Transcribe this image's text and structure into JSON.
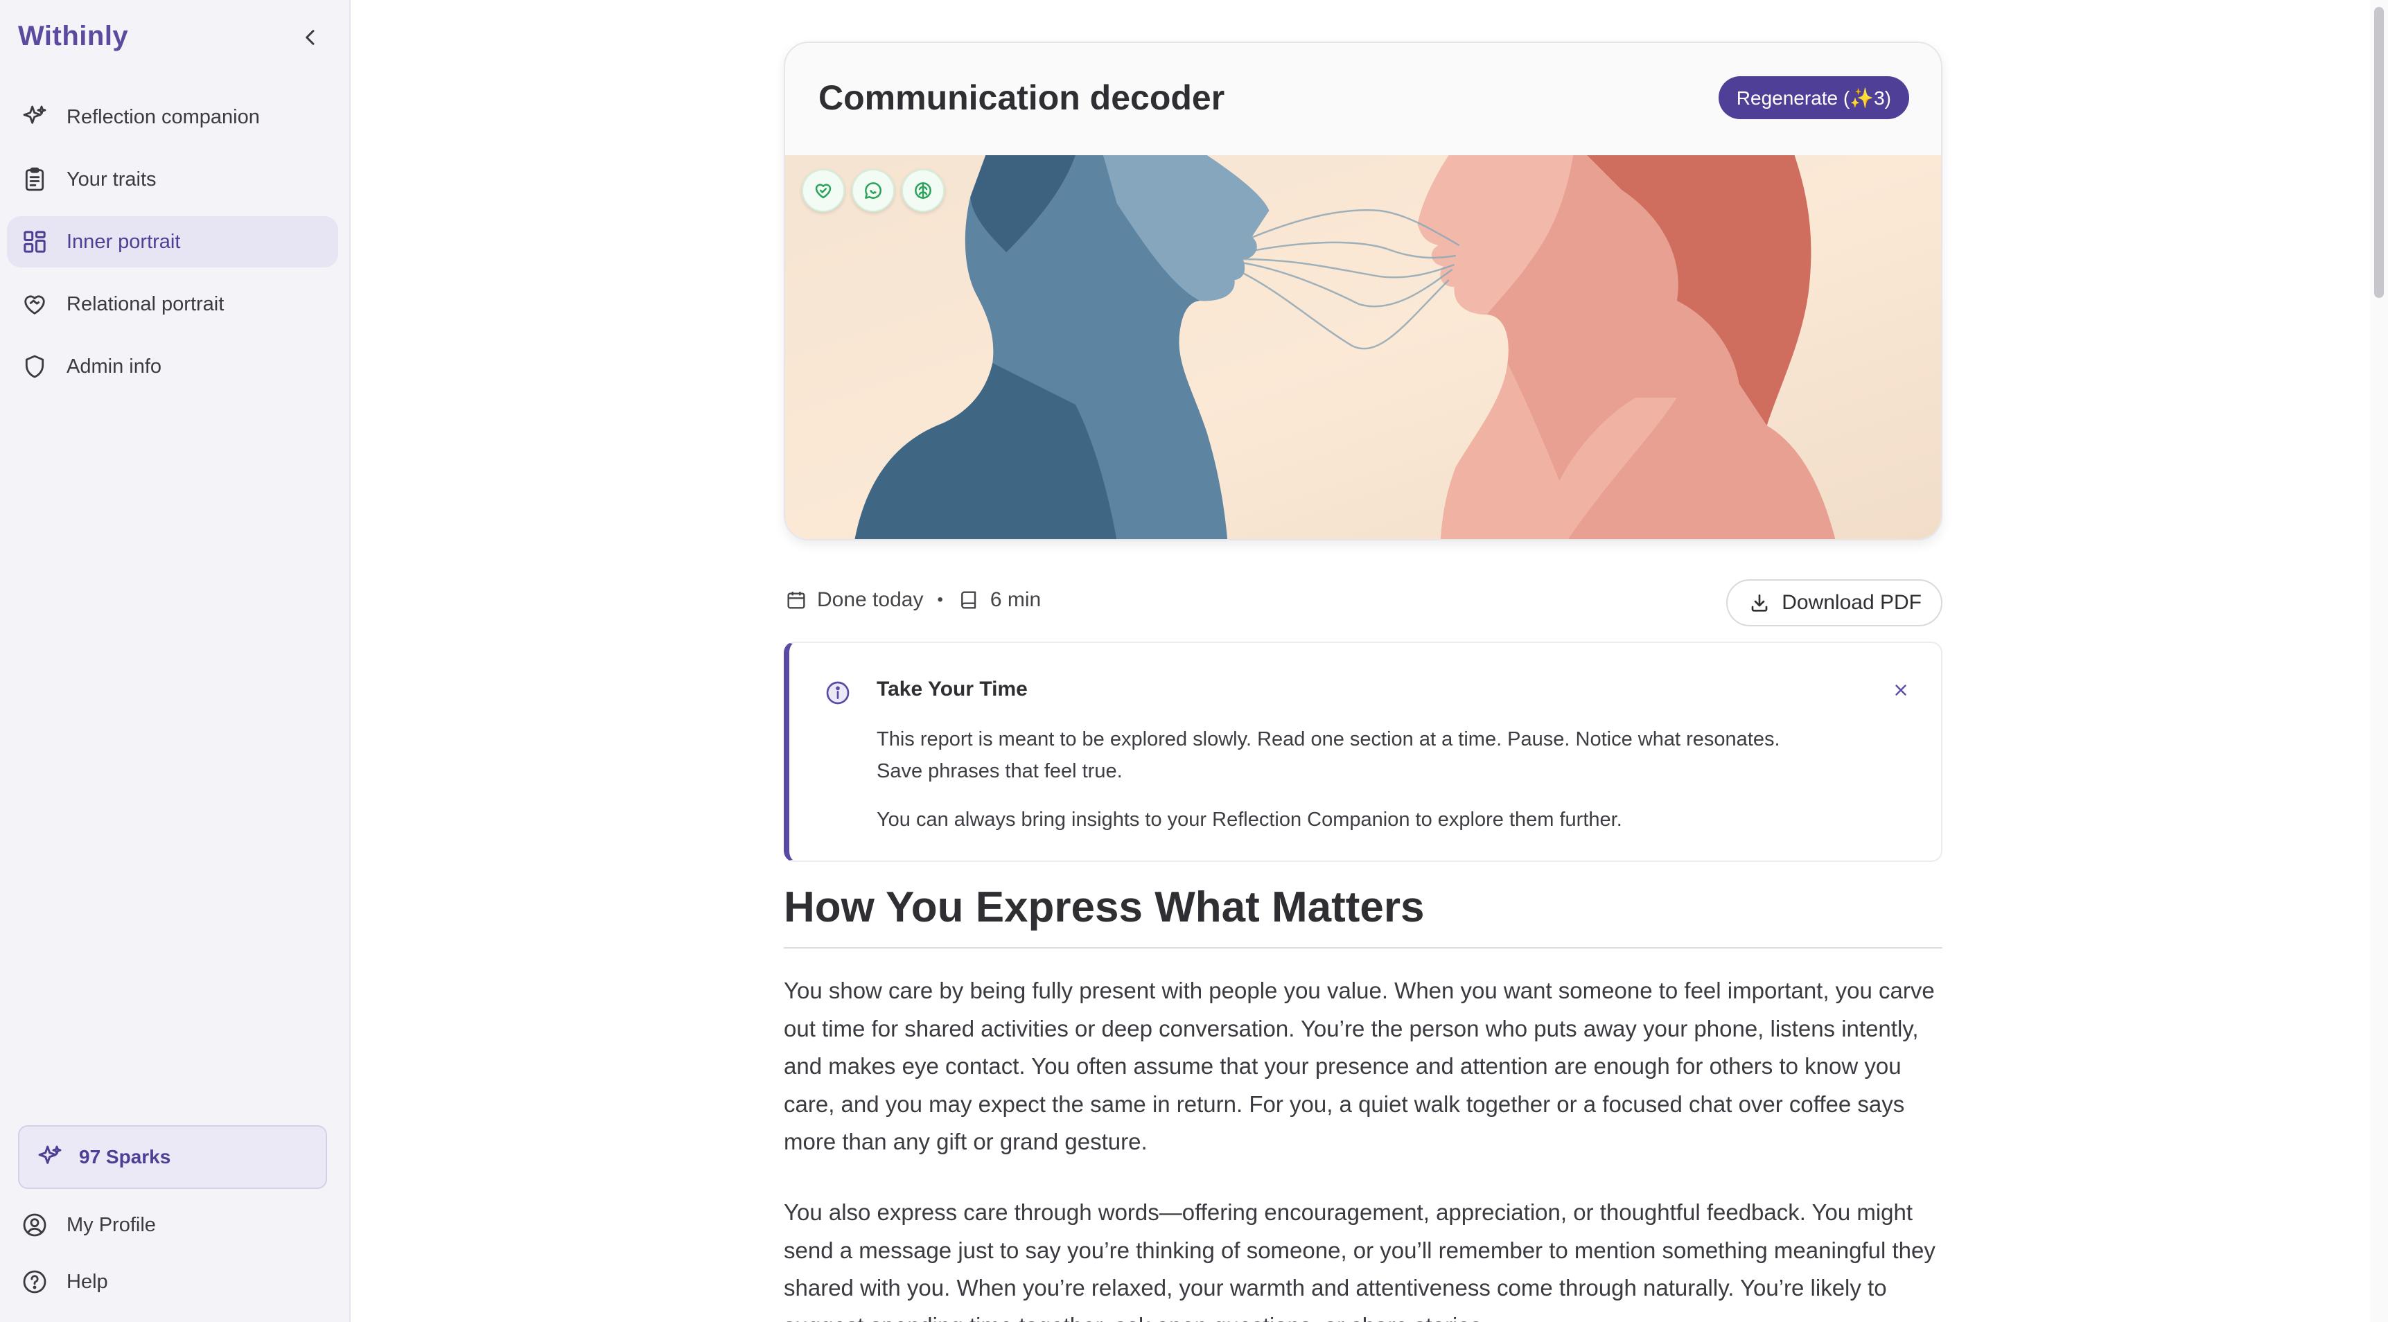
{
  "app": {
    "brand": "Withinly"
  },
  "sidebar": {
    "items": [
      {
        "label": "Reflection companion",
        "icon": "sparkles-icon"
      },
      {
        "label": "Your traits",
        "icon": "clipboard-icon"
      },
      {
        "label": "Inner portrait",
        "icon": "grid-icon",
        "active": true
      },
      {
        "label": "Relational portrait",
        "icon": "heart-handshake-icon"
      },
      {
        "label": "Admin info",
        "icon": "shield-icon"
      }
    ],
    "sparks_label": "97 Sparks",
    "profile_label": "My Profile",
    "help_label": "Help"
  },
  "card": {
    "title": "Communication decoder",
    "regenerate_label": "Regenerate (✨3)",
    "chips": [
      "heart-check-icon",
      "chat-bubble-icon",
      "brain-icon"
    ]
  },
  "meta": {
    "date": "Done today",
    "separator": "•",
    "duration": "6 min",
    "download_label": "Download PDF"
  },
  "notice": {
    "title": "Take Your Time",
    "line1": "This report is meant to be explored slowly. Read one section at a time. Pause. Notice what resonates.",
    "line2": "Save phrases that feel true.",
    "line3": "You can always bring insights to your Reflection Companion to explore them further."
  },
  "section": {
    "title": "How You Express What Matters",
    "para1": "You show care by being fully present with people you value. When you want someone to feel important, you carve out time for shared activities or deep conversation. You’re the person who puts away your phone, listens intently, and makes eye contact. You often assume that your presence and attention are enough for others to know you care, and you may expect the same in return. For you, a quiet walk together or a focused chat over coffee says more than any gift or grand gesture.",
    "para2": "You also express care through words—offering encouragement, appreciation, or thoughtful feedback. You might send a message just to say you’re thinking of someone, or you’ll remember to mention something meaningful they shared with you. When you’re relaxed, your warmth and attentiveness come through naturally. You’re likely to suggest spending time together, ask open questions, or share stories"
  },
  "colors": {
    "accent": "#4f3f96",
    "sidebar_bg": "#f4f3f8",
    "active_nav_bg": "#e7e4f3",
    "chip_icon": "#2aa35a"
  }
}
